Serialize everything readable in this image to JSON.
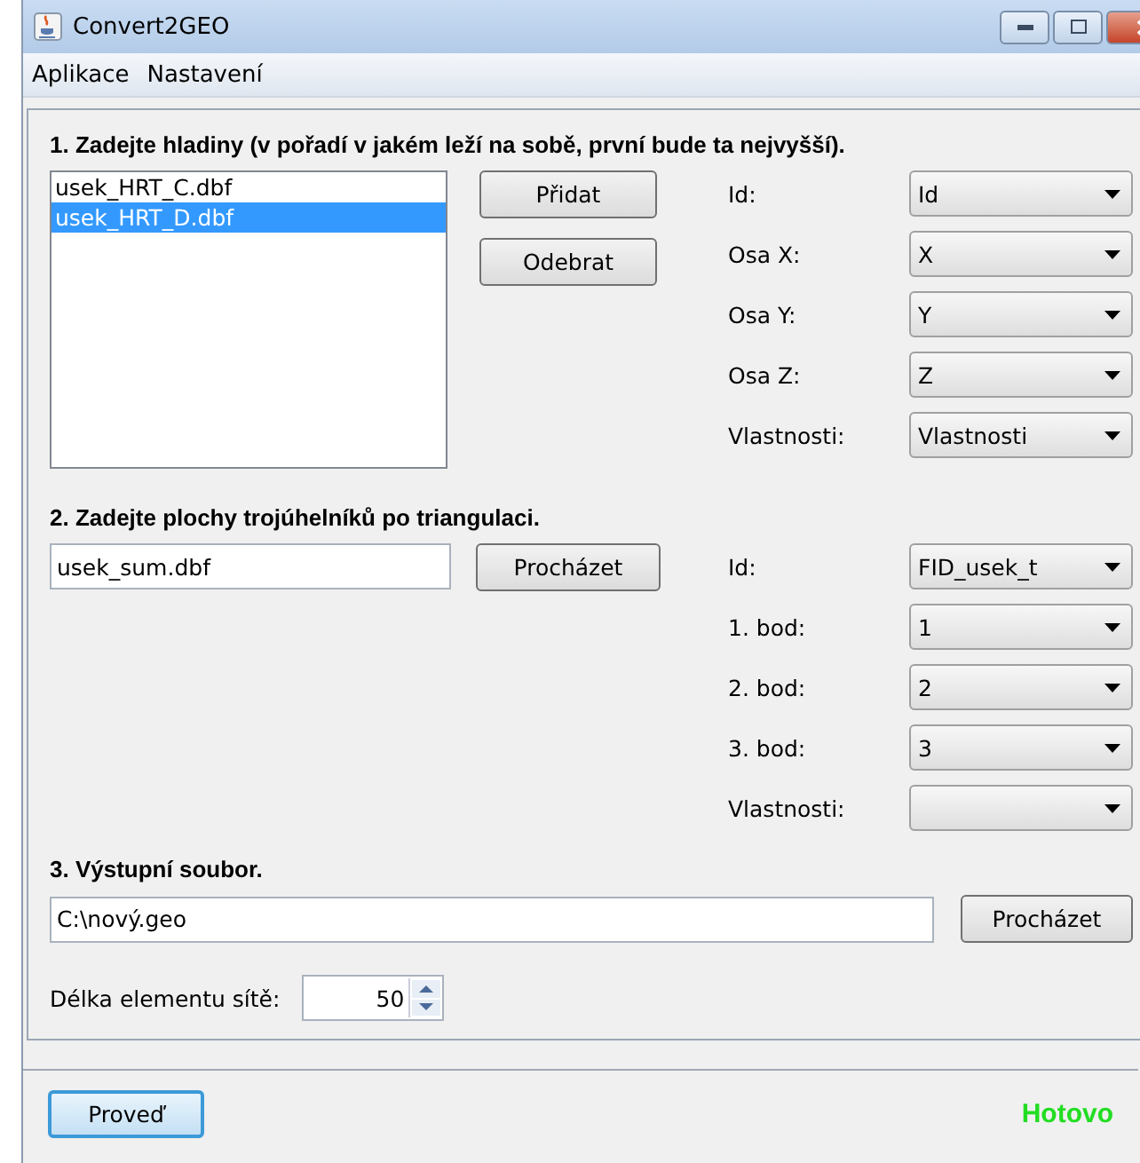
{
  "window": {
    "title": "Convert2GEO"
  },
  "menu": [
    "Aplikace",
    "Nastavení"
  ],
  "section1": {
    "title": "1. Zadejte hladiny (v pořadí v jakém leží na sobě, první bude ta nejvyšší).",
    "layers": [
      {
        "label": "usek_HRT_C.dbf",
        "selected": false
      },
      {
        "label": "usek_HRT_D.dbf",
        "selected": true
      }
    ],
    "buttons": [
      "Přidat",
      "Odebrat"
    ],
    "fields": [
      {
        "label": "Id:",
        "value": "Id"
      },
      {
        "label": "Osa X:",
        "value": "X"
      },
      {
        "label": "Osa Y:",
        "value": "Y"
      },
      {
        "label": "Osa Z:",
        "value": "Z"
      },
      {
        "label": "Vlastnosti:",
        "value": "Vlastnosti"
      }
    ]
  },
  "section2": {
    "title": "2. Zadejte plochy trojúhelníků po triangulaci.",
    "file": "usek_sum.dbf",
    "button": "Procházet",
    "fields": [
      {
        "label": "Id:",
        "value": "FID_usek_t"
      },
      {
        "label": "1. bod:",
        "value": "1"
      },
      {
        "label": "2. bod:",
        "value": "2"
      },
      {
        "label": "3. bod:",
        "value": "3"
      },
      {
        "label": "Vlastnosti:"
      }
    ]
  },
  "section3": {
    "title": "3. Výstupní soubor.",
    "file": "C:\\nový.geo",
    "button": "Procházet"
  },
  "mesh": {
    "label": "Délka elementu sítě:",
    "value": "50"
  },
  "run_button": "Proveď",
  "status": "Hotovo"
}
